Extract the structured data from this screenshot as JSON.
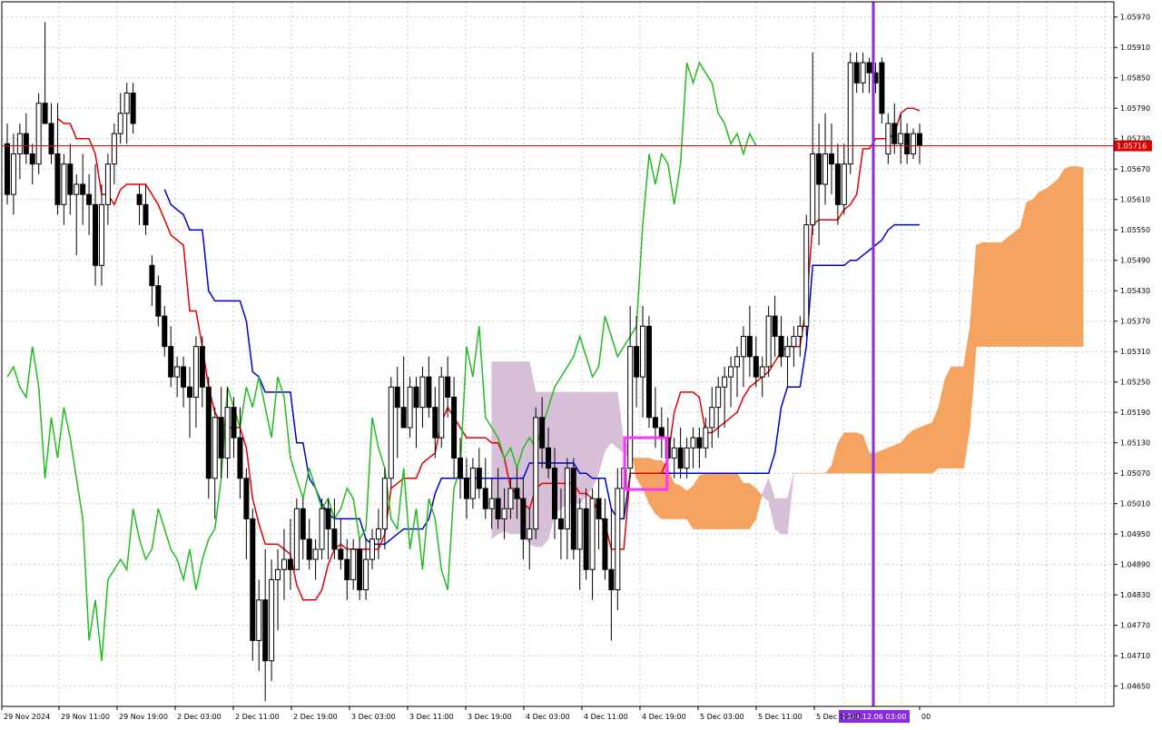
{
  "chart_data": {
    "type": "candlestick",
    "instrument_note": "",
    "y_ticks": [
      "1.05970",
      "1.05910",
      "1.05850",
      "1.05790",
      "1.05730",
      "1.05670",
      "1.05610",
      "1.05550",
      "1.05490",
      "1.05430",
      "1.05370",
      "1.05310",
      "1.05250",
      "1.05190",
      "1.05130",
      "1.05070",
      "1.05010",
      "1.04950",
      "1.04890",
      "1.04830",
      "1.04770",
      "1.04710",
      "1.04650"
    ],
    "ylim": [
      1.0461,
      1.06
    ],
    "current_price_label": "1.05716",
    "current_price": 1.05716,
    "x_labels": [
      "29 Nov 2024",
      "29 Nov 11:00",
      "29 Nov 19:00",
      "2 Dec 03:00",
      "2 Dec 11:00",
      "2 Dec 19:00",
      "3 Dec 03:00",
      "3 Dec 11:00",
      "3 Dec 19:00",
      "4 Dec 03:00",
      "4 Dec 11:00",
      "4 Dec 19:00",
      "5 Dec 03:00",
      "5 Dec 11:00",
      "5 Dec 19:00",
      "00"
    ],
    "crosshair_time_label": "2024.12.06 03:00",
    "grid": true,
    "colors": {
      "bull_body": "#ffffff",
      "bear_body": "#000000",
      "wick": "#000000",
      "tenkan": "#e00000",
      "kijun": "#0000cc",
      "chikou": "#22bb22",
      "cloud_bull": "#f4a460",
      "cloud_bear": "#d8bfd8",
      "price_line": "#e00000",
      "crosshair": "#8a2be2",
      "highlight_box": "#ff33ff"
    },
    "candles": [
      [
        1.0572,
        1.0576,
        1.056,
        1.0562
      ],
      [
        1.0562,
        1.0574,
        1.0558,
        1.057
      ],
      [
        1.057,
        1.0576,
        1.0565,
        1.0574
      ],
      [
        1.0574,
        1.0578,
        1.0568,
        1.057
      ],
      [
        1.057,
        1.0572,
        1.0564,
        1.0568
      ],
      [
        1.0568,
        1.0582,
        1.0566,
        1.058
      ],
      [
        1.058,
        1.0596,
        1.0576,
        1.0576
      ],
      [
        1.0576,
        1.058,
        1.0568,
        1.057
      ],
      [
        1.057,
        1.058,
        1.0558,
        1.056
      ],
      [
        1.056,
        1.057,
        1.0556,
        1.0568
      ],
      [
        1.0568,
        1.0572,
        1.0558,
        1.0562
      ],
      [
        1.0562,
        1.0566,
        1.055,
        1.0564
      ],
      [
        1.0564,
        1.057,
        1.0556,
        1.0562
      ],
      [
        1.0562,
        1.0566,
        1.0554,
        1.056
      ],
      [
        1.056,
        1.0568,
        1.0544,
        1.0548
      ],
      [
        1.0548,
        1.0564,
        1.0544,
        1.056
      ],
      [
        1.056,
        1.057,
        1.0556,
        1.0568
      ],
      [
        1.0568,
        1.0576,
        1.0564,
        1.0574
      ],
      [
        1.0574,
        1.0582,
        1.0572,
        1.0578
      ],
      [
        1.0578,
        1.0584,
        1.0572,
        1.0582
      ],
      [
        1.0582,
        1.0584,
        1.0574,
        1.0576
      ],
      [
        1.0562,
        1.0564,
        1.0556,
        1.056
      ],
      [
        1.056,
        1.0564,
        1.0554,
        1.0556
      ],
      [
        1.0548,
        1.055,
        1.054,
        1.0544
      ],
      [
        1.0544,
        1.0546,
        1.0536,
        1.0538
      ],
      [
        1.0538,
        1.054,
        1.053,
        1.0532
      ],
      [
        1.0532,
        1.0536,
        1.0524,
        1.0526
      ],
      [
        1.0526,
        1.053,
        1.0522,
        1.0528
      ],
      [
        1.0528,
        1.053,
        1.052,
        1.0524
      ],
      [
        1.0524,
        1.0528,
        1.0514,
        1.0522
      ],
      [
        1.0522,
        1.0534,
        1.0516,
        1.0532
      ],
      [
        1.0532,
        1.0534,
        1.052,
        1.0524
      ],
      [
        1.0524,
        1.0526,
        1.0502,
        1.0506
      ],
      [
        1.0506,
        1.052,
        1.0498,
        1.0518
      ],
      [
        1.0518,
        1.0524,
        1.0506,
        1.051
      ],
      [
        1.051,
        1.0524,
        1.0506,
        1.052
      ],
      [
        1.052,
        1.0522,
        1.051,
        1.0514
      ],
      [
        1.0514,
        1.052,
        1.0502,
        1.0506
      ],
      [
        1.0506,
        1.0508,
        1.049,
        1.0498
      ],
      [
        1.0498,
        1.05,
        1.047,
        1.0474
      ],
      [
        1.0474,
        1.0486,
        1.0468,
        1.0482
      ],
      [
        1.0482,
        1.0492,
        1.0462,
        1.047
      ],
      [
        1.047,
        1.049,
        1.0466,
        1.0486
      ],
      [
        1.0486,
        1.0492,
        1.0476,
        1.0488
      ],
      [
        1.0488,
        1.0496,
        1.0482,
        1.049
      ],
      [
        1.049,
        1.0498,
        1.0484,
        1.0488
      ],
      [
        1.0488,
        1.0502,
        1.0488,
        1.05
      ],
      [
        1.05,
        1.0502,
        1.049,
        1.0494
      ],
      [
        1.0494,
        1.0498,
        1.0488,
        1.049
      ],
      [
        1.049,
        1.0494,
        1.0486,
        1.0492
      ],
      [
        1.0492,
        1.0502,
        1.049,
        1.05
      ],
      [
        1.05,
        1.0502,
        1.049,
        1.0496
      ],
      [
        1.0496,
        1.0502,
        1.049,
        1.0492
      ],
      [
        1.0492,
        1.0498,
        1.0488,
        1.049
      ],
      [
        1.049,
        1.0494,
        1.0482,
        1.0486
      ],
      [
        1.0486,
        1.0494,
        1.0484,
        1.0492
      ],
      [
        1.0492,
        1.0494,
        1.0482,
        1.0484
      ],
      [
        1.0484,
        1.0494,
        1.0482,
        1.049
      ],
      [
        1.049,
        1.0496,
        1.0488,
        1.0494
      ],
      [
        1.0494,
        1.05,
        1.049,
        1.0496
      ],
      [
        1.0496,
        1.0508,
        1.0492,
        1.0506
      ],
      [
        1.0506,
        1.0526,
        1.0504,
        1.0524
      ],
      [
        1.0524,
        1.0528,
        1.051,
        1.052
      ],
      [
        1.052,
        1.053,
        1.0516,
        1.0516
      ],
      [
        1.0516,
        1.0526,
        1.0514,
        1.0524
      ],
      [
        1.0524,
        1.0526,
        1.0512,
        1.052
      ],
      [
        1.052,
        1.0528,
        1.0516,
        1.0526
      ],
      [
        1.0526,
        1.053,
        1.0518,
        1.052
      ],
      [
        1.052,
        1.0524,
        1.051,
        1.0514
      ],
      [
        1.0514,
        1.0528,
        1.0512,
        1.0526
      ],
      [
        1.0526,
        1.053,
        1.0518,
        1.0522
      ],
      [
        1.0522,
        1.0526,
        1.0506,
        1.051
      ],
      [
        1.051,
        1.0514,
        1.0502,
        1.0506
      ],
      [
        1.0506,
        1.051,
        1.0498,
        1.0502
      ],
      [
        1.0502,
        1.051,
        1.05,
        1.0508
      ],
      [
        1.0508,
        1.0512,
        1.0502,
        1.0504
      ],
      [
        1.0504,
        1.051,
        1.0498,
        1.05
      ],
      [
        1.05,
        1.0506,
        1.0496,
        1.0502
      ],
      [
        1.0502,
        1.0508,
        1.0496,
        1.0498
      ],
      [
        1.0498,
        1.0504,
        1.0494,
        1.05
      ],
      [
        1.05,
        1.0506,
        1.0498,
        1.0504
      ],
      [
        1.0504,
        1.0508,
        1.0498,
        1.0502
      ],
      [
        1.0502,
        1.0506,
        1.049,
        1.0494
      ],
      [
        1.0494,
        1.05,
        1.0488,
        1.0496
      ],
      [
        1.0496,
        1.052,
        1.0494,
        1.0518
      ],
      [
        1.0518,
        1.0522,
        1.0508,
        1.0512
      ],
      [
        1.0512,
        1.0516,
        1.0506,
        1.0508
      ],
      [
        1.0508,
        1.0512,
        1.0494,
        1.0498
      ],
      [
        1.0498,
        1.0504,
        1.049,
        1.0496
      ],
      [
        1.0496,
        1.051,
        1.049,
        1.0508
      ],
      [
        1.0508,
        1.051,
        1.049,
        1.0492
      ],
      [
        1.0492,
        1.0502,
        1.0484,
        1.05
      ],
      [
        1.05,
        1.0504,
        1.0486,
        1.0488
      ],
      [
        1.0488,
        1.0504,
        1.0482,
        1.0502
      ],
      [
        1.0502,
        1.0506,
        1.0492,
        1.0498
      ],
      [
        1.0498,
        1.0502,
        1.0486,
        1.0488
      ],
      [
        1.0488,
        1.05,
        1.0474,
        1.0484
      ],
      [
        1.0484,
        1.0508,
        1.048,
        1.0504
      ],
      [
        1.0504,
        1.051,
        1.0498,
        1.0508
      ],
      [
        1.0508,
        1.054,
        1.0506,
        1.0532
      ],
      [
        1.0532,
        1.0538,
        1.052,
        1.0526
      ],
      [
        1.0526,
        1.054,
        1.0518,
        1.0536
      ],
      [
        1.0536,
        1.0538,
        1.0516,
        1.0518
      ],
      [
        1.0518,
        1.0524,
        1.0512,
        1.0516
      ],
      [
        1.0516,
        1.052,
        1.051,
        1.0514
      ],
      [
        1.0514,
        1.0518,
        1.0508,
        1.051
      ],
      [
        1.051,
        1.0514,
        1.0506,
        1.0512
      ],
      [
        1.0512,
        1.0516,
        1.0506,
        1.0508
      ],
      [
        1.0508,
        1.0514,
        1.0506,
        1.0512
      ],
      [
        1.0512,
        1.0516,
        1.0508,
        1.0514
      ],
      [
        1.0514,
        1.0516,
        1.0508,
        1.0512
      ],
      [
        1.0512,
        1.0518,
        1.051,
        1.0516
      ],
      [
        1.0516,
        1.0524,
        1.0512,
        1.052
      ],
      [
        1.052,
        1.0526,
        1.0514,
        1.0524
      ],
      [
        1.0524,
        1.0528,
        1.0516,
        1.0526
      ],
      [
        1.0526,
        1.053,
        1.052,
        1.0528
      ],
      [
        1.0528,
        1.0532,
        1.0522,
        1.053
      ],
      [
        1.053,
        1.0536,
        1.0524,
        1.0534
      ],
      [
        1.0534,
        1.054,
        1.0526,
        1.053
      ],
      [
        1.053,
        1.0534,
        1.0524,
        1.0526
      ],
      [
        1.0526,
        1.053,
        1.0522,
        1.0528
      ],
      [
        1.0528,
        1.054,
        1.0526,
        1.0538
      ],
      [
        1.0538,
        1.0542,
        1.053,
        1.0534
      ],
      [
        1.0534,
        1.0538,
        1.0528,
        1.053
      ],
      [
        1.053,
        1.0534,
        1.0524,
        1.0532
      ],
      [
        1.0532,
        1.0536,
        1.0528,
        1.0534
      ],
      [
        1.0534,
        1.0538,
        1.053,
        1.0536
      ],
      [
        1.0536,
        1.0558,
        1.0534,
        1.0556
      ],
      [
        1.0556,
        1.059,
        1.0554,
        1.057
      ],
      [
        1.057,
        1.0576,
        1.0552,
        1.0564
      ],
      [
        1.0564,
        1.0578,
        1.056,
        1.057
      ],
      [
        1.057,
        1.0576,
        1.0562,
        1.0568
      ],
      [
        1.0568,
        1.0572,
        1.0556,
        1.056
      ],
      [
        1.056,
        1.0572,
        1.0558,
        1.0568
      ],
      [
        1.0568,
        1.059,
        1.0566,
        1.0588
      ],
      [
        1.0588,
        1.059,
        1.0582,
        1.0584
      ],
      [
        1.0584,
        1.059,
        1.0582,
        1.0588
      ],
      [
        1.0588,
        1.0589,
        1.0582,
        1.0586
      ],
      [
        1.0586,
        1.0588,
        1.0582,
        1.0584
      ],
      [
        1.0588,
        1.0589,
        1.0576,
        1.0578
      ]
    ],
    "candles_tail": [
      [
        1.057,
        1.0578,
        1.0568,
        1.0576
      ],
      [
        1.0576,
        1.058,
        1.057,
        1.0572
      ],
      [
        1.0572,
        1.0578,
        1.0568,
        1.0574
      ],
      [
        1.0574,
        1.0576,
        1.0568,
        1.057
      ],
      [
        1.057,
        1.0575,
        1.0569,
        1.0574
      ],
      [
        1.0574,
        1.0576,
        1.0568,
        1.05716
      ]
    ]
  }
}
